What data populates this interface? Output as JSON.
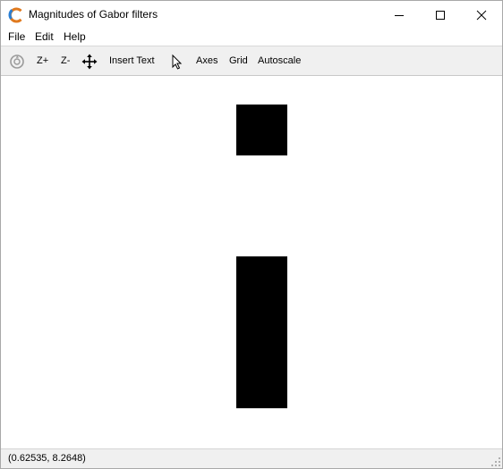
{
  "window": {
    "title": "Magnitudes of Gabor filters"
  },
  "menu": {
    "items": [
      "File",
      "Edit",
      "Help"
    ]
  },
  "toolbar": {
    "zoom_in_label": "Z+",
    "zoom_out_label": "Z-",
    "insert_text_label": "Insert Text",
    "axes_label": "Axes",
    "grid_label": "Grid",
    "autoscale_label": "Autoscale",
    "icons": [
      "rotate-icon",
      "pan-icon",
      "select-pointer-icon"
    ]
  },
  "status": {
    "coordinates": "(0.62535, 8.2648)"
  },
  "colors": {
    "bar_fill": "#000000",
    "toolbar_bg": "#f0f0f0",
    "plot_bg": "#ffffff"
  }
}
